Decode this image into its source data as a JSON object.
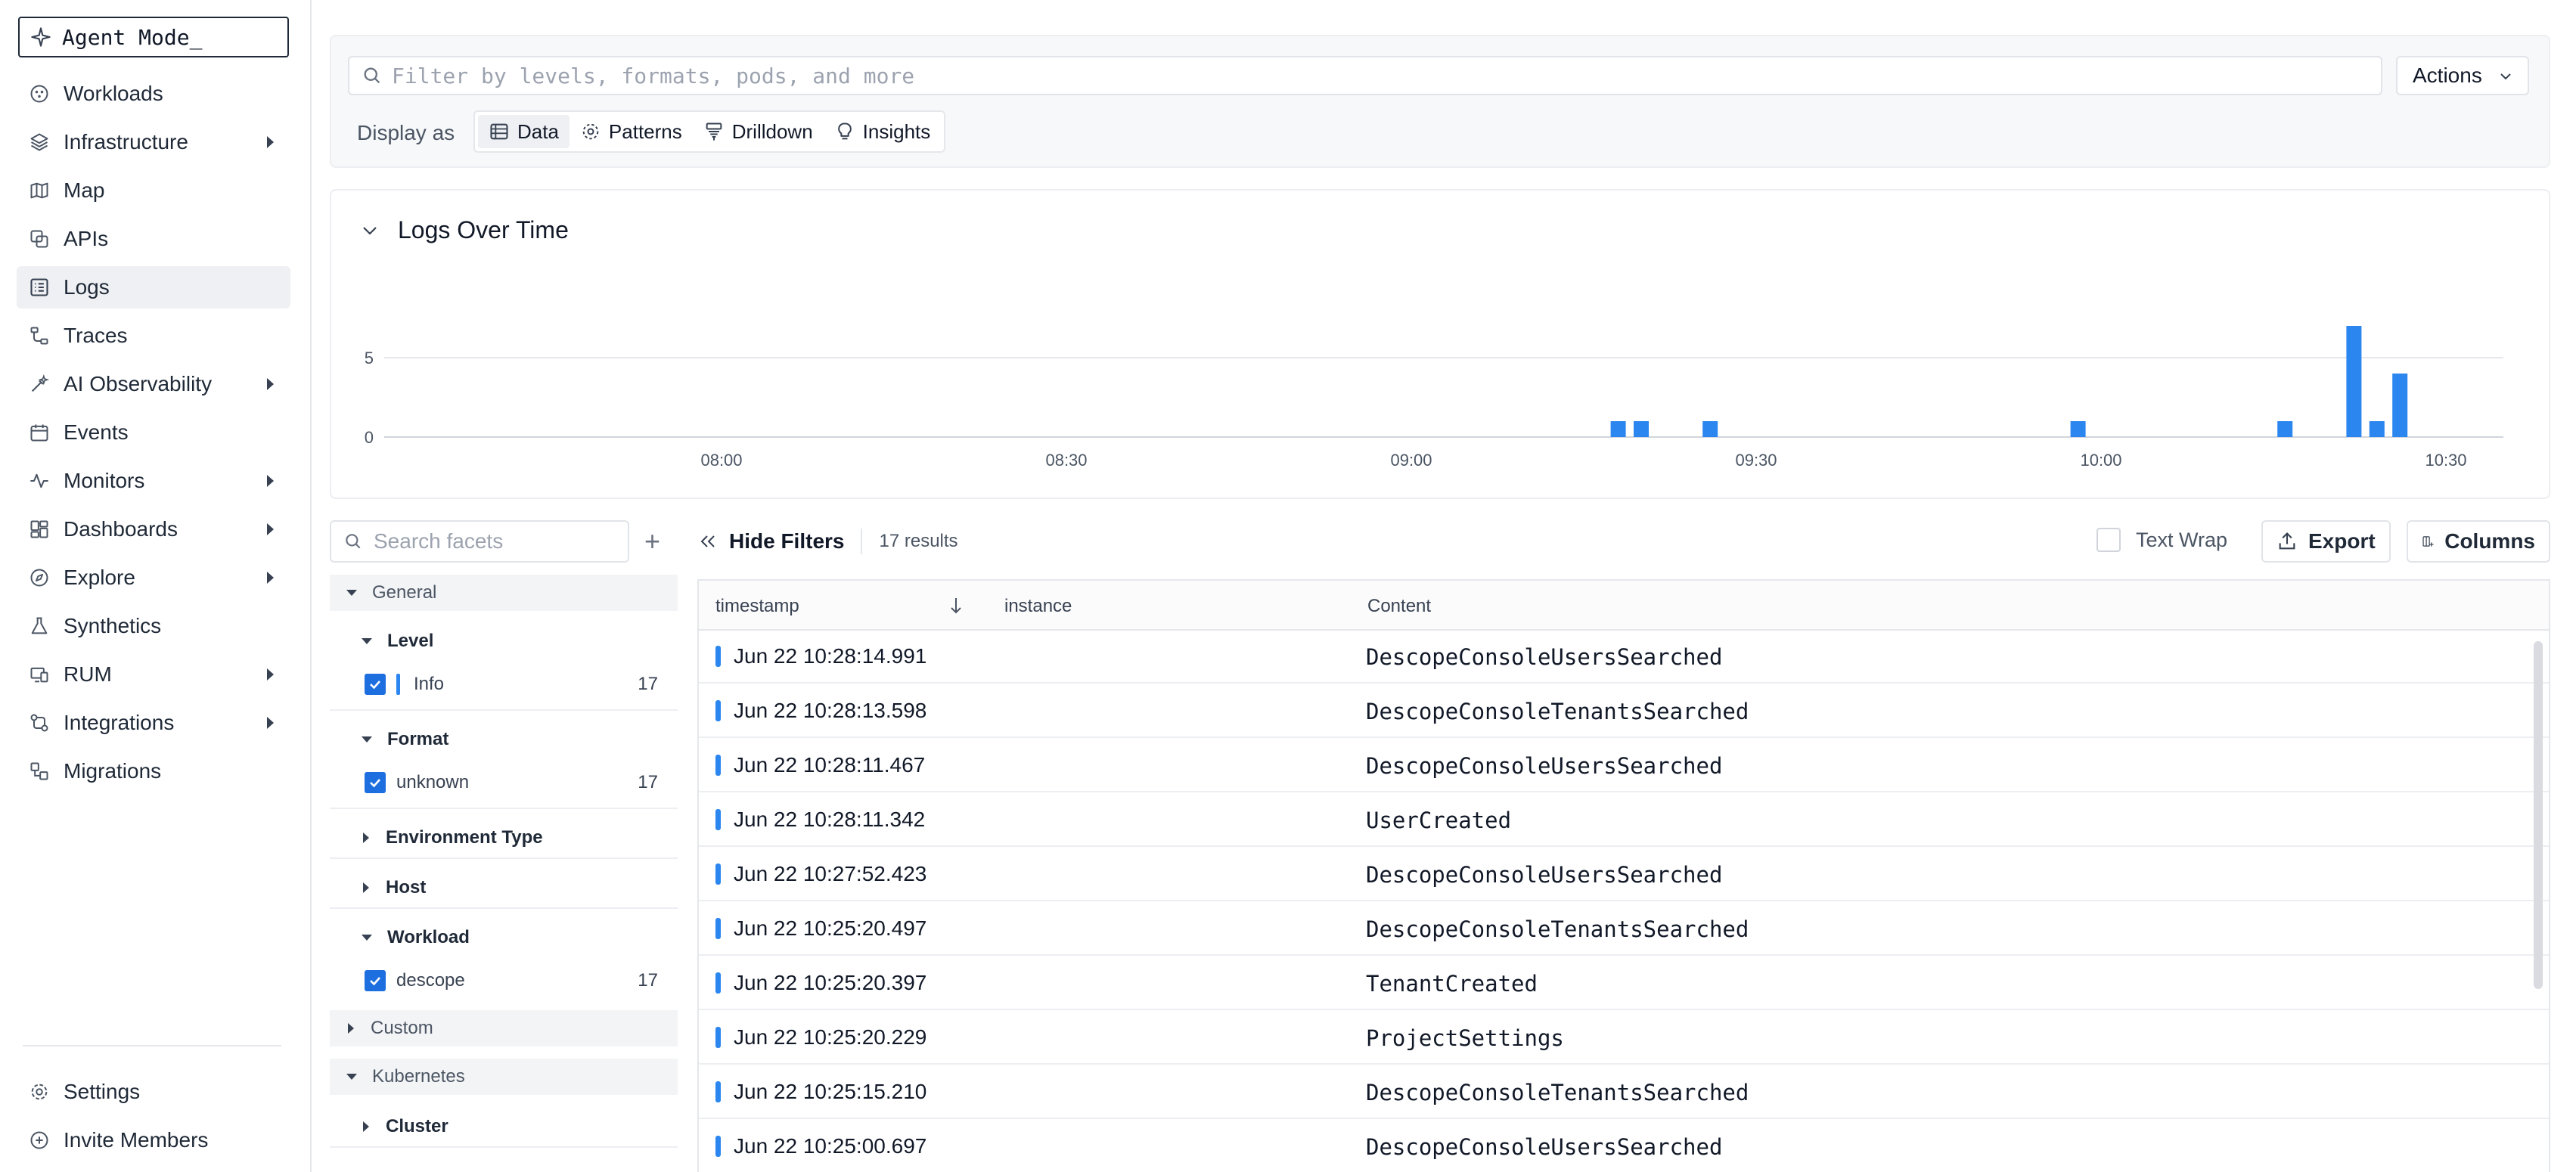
{
  "sidebar": {
    "agent_mode": "Agent Mode_",
    "items": [
      {
        "label": "Workloads"
      },
      {
        "label": "Infrastructure"
      },
      {
        "label": "Map"
      },
      {
        "label": "APIs"
      },
      {
        "label": "Logs"
      },
      {
        "label": "Traces"
      },
      {
        "label": "AI Observability"
      },
      {
        "label": "Events"
      },
      {
        "label": "Monitors"
      },
      {
        "label": "Dashboards"
      },
      {
        "label": "Explore"
      },
      {
        "label": "Synthetics"
      },
      {
        "label": "RUM"
      },
      {
        "label": "Integrations"
      },
      {
        "label": "Migrations"
      }
    ],
    "bottom": [
      {
        "label": "Settings"
      },
      {
        "label": "Invite Members"
      }
    ]
  },
  "filter": {
    "placeholder": "Filter by levels, formats, pods, and more",
    "actions_label": "Actions",
    "display_as": "Display as",
    "modes": [
      "Data",
      "Patterns",
      "Drilldown",
      "Insights"
    ]
  },
  "chart": {
    "title": "Logs Over Time",
    "y_ticks": [
      "5",
      "0"
    ],
    "x_ticks": [
      "08:00",
      "08:30",
      "09:00",
      "09:30",
      "10:00",
      "10:30"
    ]
  },
  "chart_data": {
    "type": "bar",
    "title": "Logs Over Time",
    "xlabel": "",
    "ylabel": "",
    "ylim": [
      0,
      8
    ],
    "grid": true,
    "color": "#2b86f0",
    "x": [
      "09:18",
      "09:20",
      "09:26",
      "09:58",
      "10:16",
      "10:22",
      "10:24",
      "10:26"
    ],
    "values": [
      1,
      1,
      1,
      1,
      1,
      7,
      1,
      4
    ]
  },
  "facets": {
    "search_placeholder": "Search facets",
    "general": "General",
    "level": {
      "title": "Level",
      "value": "Info",
      "count": "17"
    },
    "format": {
      "title": "Format",
      "value": "unknown",
      "count": "17"
    },
    "environment_type": "Environment Type",
    "host": "Host",
    "workload": {
      "title": "Workload",
      "value": "descope",
      "count": "17"
    },
    "custom": "Custom",
    "kubernetes": "Kubernetes",
    "cluster": "Cluster"
  },
  "toolbar": {
    "hide_filters": "Hide Filters",
    "results": "17 results",
    "text_wrap": "Text Wrap",
    "export": "Export",
    "columns": "Columns"
  },
  "table": {
    "columns": [
      "timestamp",
      "instance",
      "Content"
    ],
    "rows": [
      {
        "timestamp": "Jun 22 10:28:14.991",
        "instance": "",
        "content": "DescopeConsoleUsersSearched"
      },
      {
        "timestamp": "Jun 22 10:28:13.598",
        "instance": "",
        "content": "DescopeConsoleTenantsSearched"
      },
      {
        "timestamp": "Jun 22 10:28:11.467",
        "instance": "",
        "content": "DescopeConsoleUsersSearched"
      },
      {
        "timestamp": "Jun 22 10:28:11.342",
        "instance": "",
        "content": "UserCreated"
      },
      {
        "timestamp": "Jun 22 10:27:52.423",
        "instance": "",
        "content": "DescopeConsoleUsersSearched"
      },
      {
        "timestamp": "Jun 22 10:25:20.497",
        "instance": "",
        "content": "DescopeConsoleTenantsSearched"
      },
      {
        "timestamp": "Jun 22 10:25:20.397",
        "instance": "",
        "content": "TenantCreated"
      },
      {
        "timestamp": "Jun 22 10:25:20.229",
        "instance": "",
        "content": "ProjectSettings"
      },
      {
        "timestamp": "Jun 22 10:25:15.210",
        "instance": "",
        "content": "DescopeConsoleTenantsSearched"
      },
      {
        "timestamp": "Jun 22 10:25:00.697",
        "instance": "",
        "content": "DescopeConsoleUsersSearched"
      }
    ]
  }
}
